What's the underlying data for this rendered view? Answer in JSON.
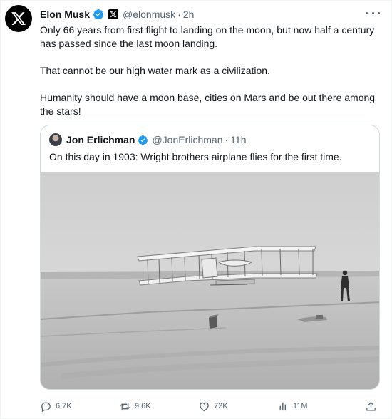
{
  "author": {
    "name": "Elon Musk",
    "handle": "@elonmusk",
    "separator": "·",
    "time": "2h",
    "avatar_icon": "x-logo-icon"
  },
  "tweet": {
    "paragraphs": [
      "Only 66 years from first flight to landing on the moon, but now half a century has passed since the last moon landing.",
      "That cannot be our high water mark as a civilization.",
      "Humanity should have a moon base, cities on Mars and be out there among the stars!"
    ]
  },
  "quoted": {
    "name": "Jon Erlichman",
    "handle": "@JonErlichman",
    "separator": "·",
    "time": "11h",
    "text": "On this day in 1903: Wright brothers airplane flies for the first time."
  },
  "actions": {
    "replies": "6.7K",
    "reposts": "9.6K",
    "likes": "72K",
    "views": "11M"
  },
  "colors": {
    "verified": "#1d9bf0",
    "secondary_text": "#536471",
    "border": "#cfd9de"
  }
}
